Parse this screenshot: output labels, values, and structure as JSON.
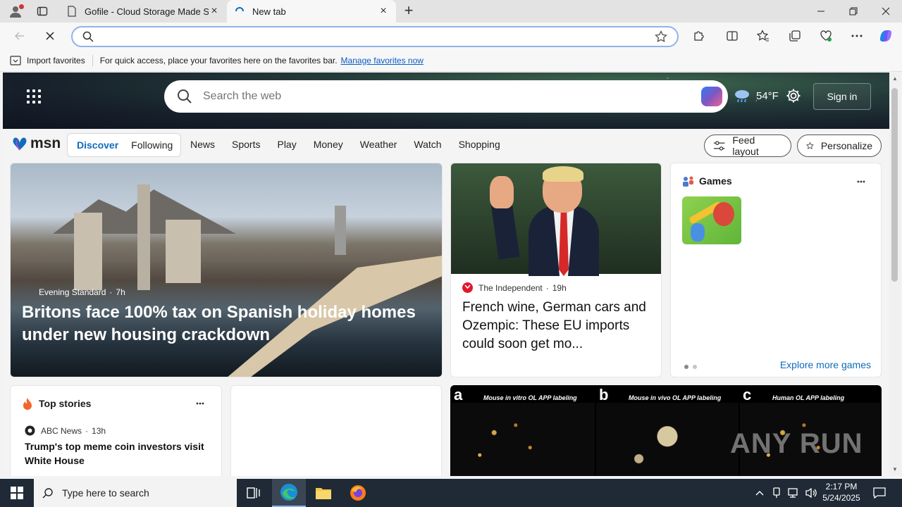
{
  "browser": {
    "tabs": [
      {
        "title": "Gofile - Cloud Storage Made Sim",
        "active": false
      },
      {
        "title": "New tab",
        "active": true
      }
    ],
    "address": {
      "value": "",
      "placeholder": ""
    },
    "favorites_bar": {
      "import_label": "Import favorites",
      "hint": "For quick access, place your favorites here on the favorites bar.",
      "manage_link": "Manage favorites now"
    }
  },
  "msn": {
    "search_placeholder": "Search the web",
    "weather": {
      "temp": "54°F",
      "icon": "cloud-rain-icon"
    },
    "signin_label": "Sign in",
    "logo_text": "msn",
    "feed_tabs": [
      {
        "label": "Discover",
        "active": true
      },
      {
        "label": "Following",
        "active": false
      }
    ],
    "categories": [
      "News",
      "Sports",
      "Play",
      "Money",
      "Weather",
      "Watch",
      "Shopping"
    ],
    "feed_layout_label": "Feed layout",
    "personalize_label": "Personalize",
    "hero_story": {
      "source": "Evening Standard",
      "age": "7h",
      "headline": "Britons face 100% tax on Spanish holiday homes under new housing crackdown"
    },
    "second_story": {
      "source": "The Independent",
      "age": "19h",
      "headline": "French wine, German cars and Ozempic: These EU imports could soon get mo..."
    },
    "games": {
      "title": "Games",
      "explore_label": "Explore more games"
    },
    "top_stories": {
      "title": "Top stories",
      "items": [
        {
          "source": "ABC News",
          "age": "13h",
          "headline": "Trump's top meme coin investors visit White House"
        }
      ]
    },
    "science_panels": [
      {
        "letter": "a",
        "caption": "Mouse in vitro OL APP labeling"
      },
      {
        "letter": "b",
        "caption": "Mouse in vivo OL APP labeling"
      },
      {
        "letter": "c",
        "caption": "Human OL APP labeling"
      }
    ]
  },
  "taskbar": {
    "search_placeholder": "Type here to search",
    "time": "2:17 PM",
    "date": "5/24/2025"
  },
  "watermark": "ANY RUN",
  "colors": {
    "accent": "#0f6cbd",
    "taskbar": "#1f2a36",
    "link": "#0a5cc2"
  }
}
